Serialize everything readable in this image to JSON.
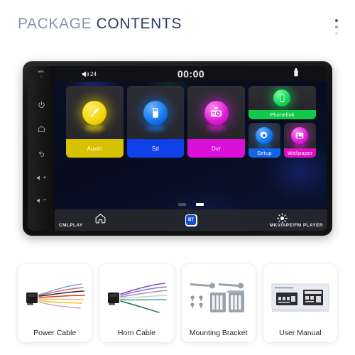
{
  "header": {
    "title_part1": "PACKAGE ",
    "title_part2": "CONTENTS",
    "menu_icon": "three-dots-vertical-icon"
  },
  "device": {
    "side_panel": {
      "mic_label": "MIC",
      "buttons": [
        {
          "name": "power-button",
          "icon": "power-icon"
        },
        {
          "name": "home-button",
          "icon": "home-icon"
        },
        {
          "name": "back-button",
          "icon": "back-arrow-icon"
        },
        {
          "name": "volume-up-button",
          "icon": "speaker-plus-icon",
          "sign": "+"
        },
        {
          "name": "volume-down-button",
          "icon": "speaker-minus-icon",
          "sign": "−"
        }
      ]
    },
    "status_bar": {
      "volume_icon": "speaker-icon",
      "volume_level": "24",
      "time": "00:00",
      "usb_icon": "usb-drive-icon"
    },
    "apps": [
      {
        "label": "AuxIn",
        "icon": "aux-plug-icon",
        "color": "#d6c200",
        "orb": "#f2d400"
      },
      {
        "label": "Sd",
        "icon": "sd-card-icon",
        "color": "#1040e8",
        "orb": "#1176ee"
      },
      {
        "label": "Dvr",
        "icon": "dashcam-icon",
        "color": "#d810d8",
        "orb": "#e218d8"
      },
      {
        "label": "Phonelink",
        "icon": "smartphone-icon",
        "color": "#12c94a",
        "orb": "#0fd44f"
      },
      {
        "label": "Setup",
        "icon": "gear-icon",
        "color": "#1464e8",
        "orb": "#1176ee"
      },
      {
        "label": "Wallpaper",
        "icon": "image-icon",
        "color": "#e010c0",
        "orb": "#e218d8"
      }
    ],
    "page_indicator": {
      "total": 2,
      "active": 2
    },
    "nav_bar": [
      {
        "name": "nav-home",
        "icon": "home-icon",
        "label": ""
      },
      {
        "name": "nav-bluetooth",
        "icon": "bluetooth-bt-icon",
        "label": "BT"
      },
      {
        "name": "nav-brightness",
        "icon": "brightness-sun-icon",
        "label": ""
      }
    ],
    "brand_left": "CMLPLAY",
    "brand_right": "MKV/APE/FM PLAYER"
  },
  "package_cards": [
    {
      "label": "Power Cable",
      "icon": "power-cable-harness-icon"
    },
    {
      "label": "Horn Cable",
      "icon": "speaker-wire-harness-icon"
    },
    {
      "label": "Mounting Bracket",
      "icon": "mounting-bracket-icon"
    },
    {
      "label": "User Manual",
      "icon": "user-manual-icon"
    }
  ],
  "colors": {
    "title_light": "#8794ad",
    "title_dark": "#2c3d63",
    "background": "#ffffff"
  }
}
